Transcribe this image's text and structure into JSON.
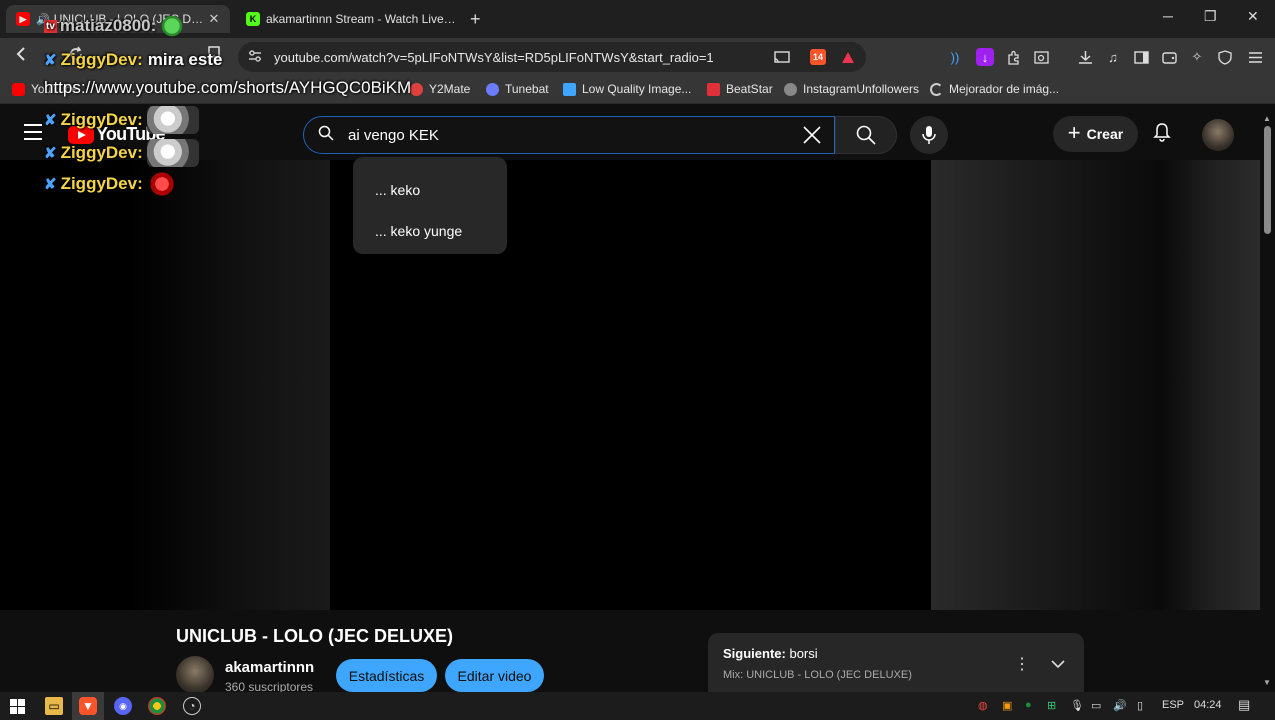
{
  "browser": {
    "tabs": [
      {
        "title": "UNICLUB - LOLO (JEC DELUXE)",
        "favicon": "youtube-icon",
        "active": true,
        "playing": true
      },
      {
        "title": "akamartinnn Stream - Watch Live on",
        "favicon": "kick-icon",
        "active": false
      }
    ],
    "new_tab": "+",
    "window_controls": {
      "minimize": "─",
      "restore": "❐",
      "close": "✕"
    },
    "url": "youtube.com/watch?v=5pLIFoNTWsY&list=RD5pLIFoNTWsY&start_radio=1",
    "shield_badge": "14",
    "bookmarks": [
      {
        "label": "YouTube",
        "color": "#ff0000"
      },
      {
        "label": "Y2Mate",
        "color": "#e04040"
      },
      {
        "label": "Tunebat",
        "color": "#6b7cff"
      },
      {
        "label": "Low Quality Image...",
        "color": "#3ea6ff"
      },
      {
        "label": "BeatStar",
        "color": "#e0303a"
      },
      {
        "label": "InstagramUnfollowers",
        "color": "#888888"
      },
      {
        "label": "Mejorador de imág...",
        "color": "#cccccc"
      }
    ]
  },
  "youtube": {
    "logo": "YouTube",
    "search_value": "ai vengo KEK",
    "suggestions": [
      "... keko",
      "... keko yunge"
    ],
    "create_label": "Crear",
    "video_title": "UNICLUB - LOLO (JEC DELUXE)",
    "channel_name": "akamartinnn",
    "subscribers": "360 suscriptores",
    "stats_button": "Estadísticas",
    "edit_button": "Editar video",
    "next_label": "Siguiente:",
    "next_title": "borsi",
    "mix_label": "Mix: UNICLUB - LOLO (JEC DELUXE)",
    "accent_color": "#3ea6ff"
  },
  "overlay": {
    "top_user": "matiaz0800:",
    "line1_user": "ZiggyDev:",
    "line1_text": "mira este",
    "line1_link": "https://www.youtube.com/shorts/AYHGQC0BiKM",
    "line2_user": "ZiggyDev:",
    "line3_user": "ZiggyDev:",
    "line4_user": "ZiggyDev:"
  },
  "taskbar": {
    "language": "ESP",
    "time": "04:24"
  }
}
